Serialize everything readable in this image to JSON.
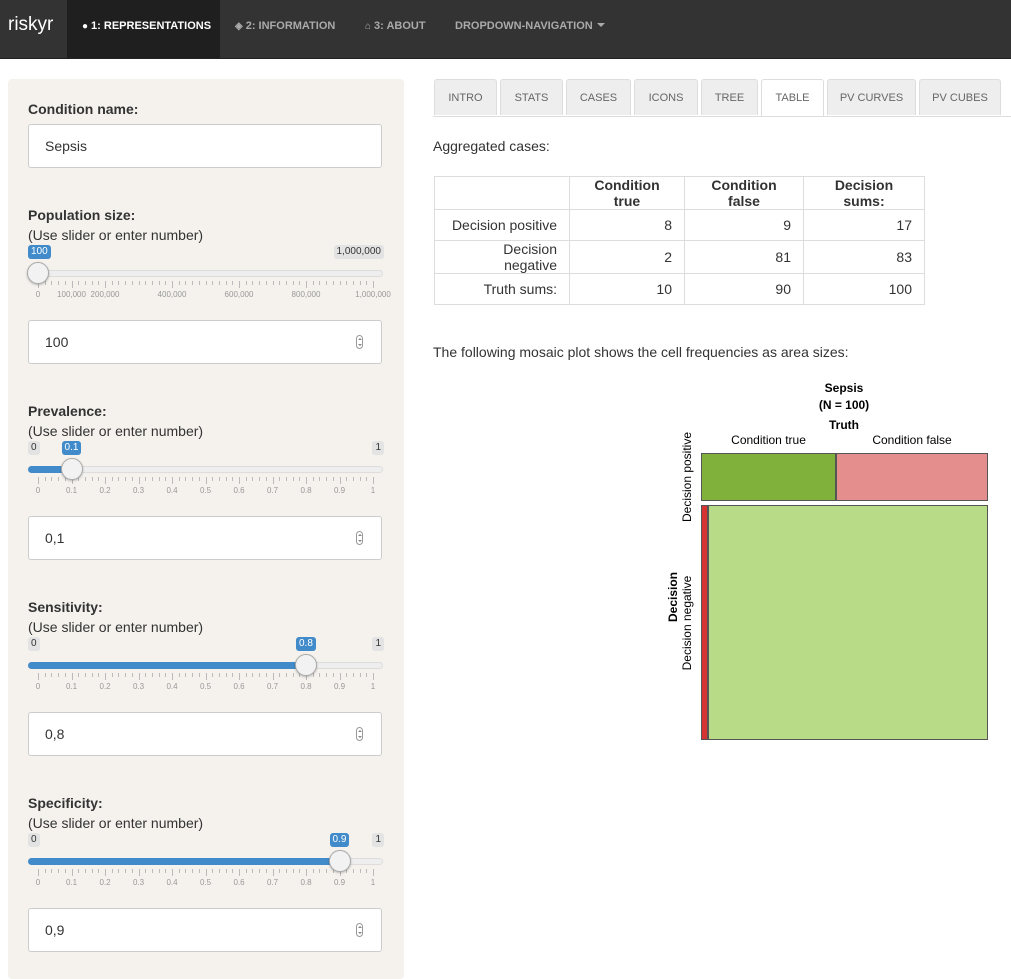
{
  "navbar": {
    "brand": "riskyr",
    "tabs": [
      {
        "label": "1: REPRESENTATIONS",
        "icon": "lightbulb-icon",
        "active": true
      },
      {
        "label": "2: INFORMATION",
        "icon": "graduation-cap-icon",
        "active": false
      },
      {
        "label": "3: ABOUT",
        "icon": "home-icon",
        "active": false
      },
      {
        "label": "DROPDOWN-NAVIGATION",
        "icon": "caret-down-icon",
        "active": false
      }
    ]
  },
  "sidebar": {
    "condition_name": {
      "label": "Condition name:",
      "value": "Sepsis"
    },
    "population": {
      "label": "Population size:",
      "hint": "(Use slider or enter number)",
      "min_label": "100",
      "max_label": "1,000,000",
      "value": 100,
      "input_value": "100",
      "ticks": [
        "0",
        "100,000",
        "200,000",
        "400,000",
        "600,000",
        "800,000",
        "1,000,000"
      ]
    },
    "prevalence": {
      "label": "Prevalence:",
      "hint": "(Use slider or enter number)",
      "min_label": "0",
      "max_label": "1",
      "current_label": "0.1",
      "value": 0.1,
      "input_value": "0,1",
      "ticks": [
        "0",
        "0.1",
        "0.2",
        "0.3",
        "0.4",
        "0.5",
        "0.6",
        "0.7",
        "0.8",
        "0.9",
        "1"
      ]
    },
    "sensitivity": {
      "label": "Sensitivity:",
      "hint": "(Use slider or enter number)",
      "min_label": "0",
      "max_label": "1",
      "current_label": "0.8",
      "value": 0.8,
      "input_value": "0,8",
      "ticks": [
        "0",
        "0.1",
        "0.2",
        "0.3",
        "0.4",
        "0.5",
        "0.6",
        "0.7",
        "0.8",
        "0.9",
        "1"
      ]
    },
    "specificity": {
      "label": "Specificity:",
      "hint": "(Use slider or enter number)",
      "min_label": "0",
      "max_label": "1",
      "current_label": "0.9",
      "value": 0.9,
      "input_value": "0,9",
      "ticks": [
        "0",
        "0.1",
        "0.2",
        "0.3",
        "0.4",
        "0.5",
        "0.6",
        "0.7",
        "0.8",
        "0.9",
        "1"
      ]
    }
  },
  "tabs": [
    "INTRO",
    "STATS",
    "CASES",
    "ICONS",
    "TREE",
    "TABLE",
    "PV CURVES",
    "PV CUBES"
  ],
  "active_tab": "TABLE",
  "main": {
    "aggregated_caption": "Aggregated cases:",
    "table": {
      "headers": [
        "",
        "Condition true",
        "Condition false",
        "Decision sums:"
      ],
      "rows": [
        [
          "Decision positive",
          "8",
          "9",
          "17"
        ],
        [
          "Decision negative",
          "2",
          "81",
          "83"
        ],
        [
          "Truth sums:",
          "10",
          "90",
          "100"
        ]
      ]
    },
    "mosaic_caption": "The following mosaic plot shows the cell frequencies as area sizes:"
  },
  "chart_data": {
    "type": "mosaic",
    "title": "Sepsis",
    "subtitle": "(N = 100)",
    "x_title": "Truth",
    "y_title": "Decision",
    "columns": [
      "Condition true",
      "Condition false"
    ],
    "rows": [
      "Decision positive",
      "Decision negative"
    ],
    "cells": [
      {
        "row": "Decision positive",
        "column": "Condition true",
        "value": 8,
        "color": "#80b13a"
      },
      {
        "row": "Decision positive",
        "column": "Condition false",
        "value": 9,
        "color": "#e58e8e"
      },
      {
        "row": "Decision negative",
        "column": "Condition true",
        "value": 2,
        "color": "#d63333"
      },
      {
        "row": "Decision negative",
        "column": "Condition false",
        "value": 81,
        "color": "#b8db88"
      }
    ]
  },
  "colors": {
    "navbar": "#333333",
    "accent": "#428bca",
    "sidebar_bg": "#f5f2ee"
  }
}
